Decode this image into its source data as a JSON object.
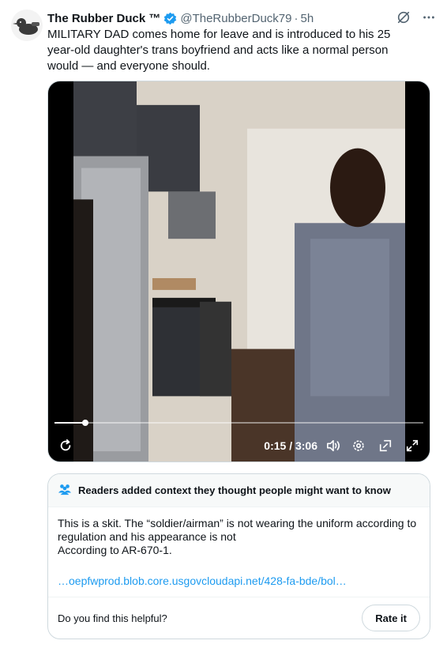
{
  "tweet": {
    "display_name": "The Rubber Duck ™",
    "handle": "@TheRubberDuck79",
    "separator": "·",
    "time": "5h",
    "text": "MILITARY DAD comes home for leave and is introduced to his 25 year-old daughter's trans boyfriend and acts like a normal person would — and everyone should.",
    "icons": [
      "grok-icon",
      "more-icon",
      "verified-badge-icon"
    ]
  },
  "video": {
    "timecode": "0:15 / 3:06",
    "progress_fraction": 0.083,
    "icons": [
      "replay-icon",
      "volume-icon",
      "settings-icon",
      "pip-icon",
      "fullscreen-icon"
    ]
  },
  "community_note": {
    "header": "Readers added context they thought people might want to know",
    "body_line1": "This is a skit. The “soldier/airman” is not wearing the uniform according to regulation and his appearance is not",
    "body_line2": "According to AR-670-1.",
    "link": "…oepfwprod.blob.core.usgovcloudapi.net/428-fa-bde/bol…",
    "helpful_prompt": "Do you find this helpful?",
    "rate_button": "Rate it"
  },
  "colors": {
    "accent": "#1d9bf0",
    "text": "#0f1419",
    "muted": "#536471",
    "border": "#cfd9de"
  }
}
